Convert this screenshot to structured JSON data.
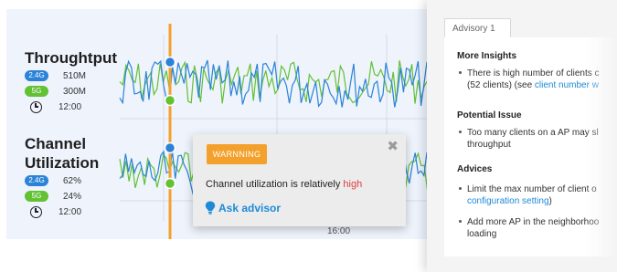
{
  "panels": {
    "throughput": {
      "title_line1": "Throughtput",
      "title_line2": "",
      "legend": [
        {
          "badge": "2.4G",
          "color": "#2b83d8",
          "value": "510M"
        },
        {
          "badge": "5G",
          "color": "#63c134",
          "value": "300M"
        }
      ],
      "time_icon": "clock-icon",
      "time": "12:00"
    },
    "utilization": {
      "title_line1": "Channel",
      "title_line2": "Utilization",
      "legend": [
        {
          "badge": "2.4G",
          "color": "#2b83d8",
          "value": "62%"
        },
        {
          "badge": "5G",
          "color": "#63c134",
          "value": "24%"
        }
      ],
      "time_icon": "clock-icon",
      "time": "12:00"
    },
    "x_axis_tick": "16:00",
    "cursor_color": "#f4a02c"
  },
  "popup": {
    "badge": "WARNNING",
    "close_icon": "close-icon",
    "message_prefix": "Channel utilization is relatively ",
    "message_highlight": "high",
    "action_icon": "lightbulb-icon",
    "action_label": "Ask advisor"
  },
  "advisory": {
    "tab_label": "Advisory 1",
    "sections": [
      {
        "title": "More Insights",
        "bullets": [
          {
            "line1": "There is high number of clients c",
            "line2_text": "(52 clients) (see ",
            "line2_link": "client number w"
          }
        ]
      },
      {
        "title": "Potential Issue",
        "bullets": [
          {
            "line1": "Too many clients on a AP may sl",
            "line2_text": "throughput"
          }
        ]
      },
      {
        "title": "Advices",
        "bullets": [
          {
            "line1": "Limit the max number of client o",
            "line2_link": "configuration setting",
            "line2_suffix": ")"
          },
          {
            "line1": "Add more AP in the neighborhoo",
            "line2_text": "loading"
          }
        ]
      }
    ]
  }
}
